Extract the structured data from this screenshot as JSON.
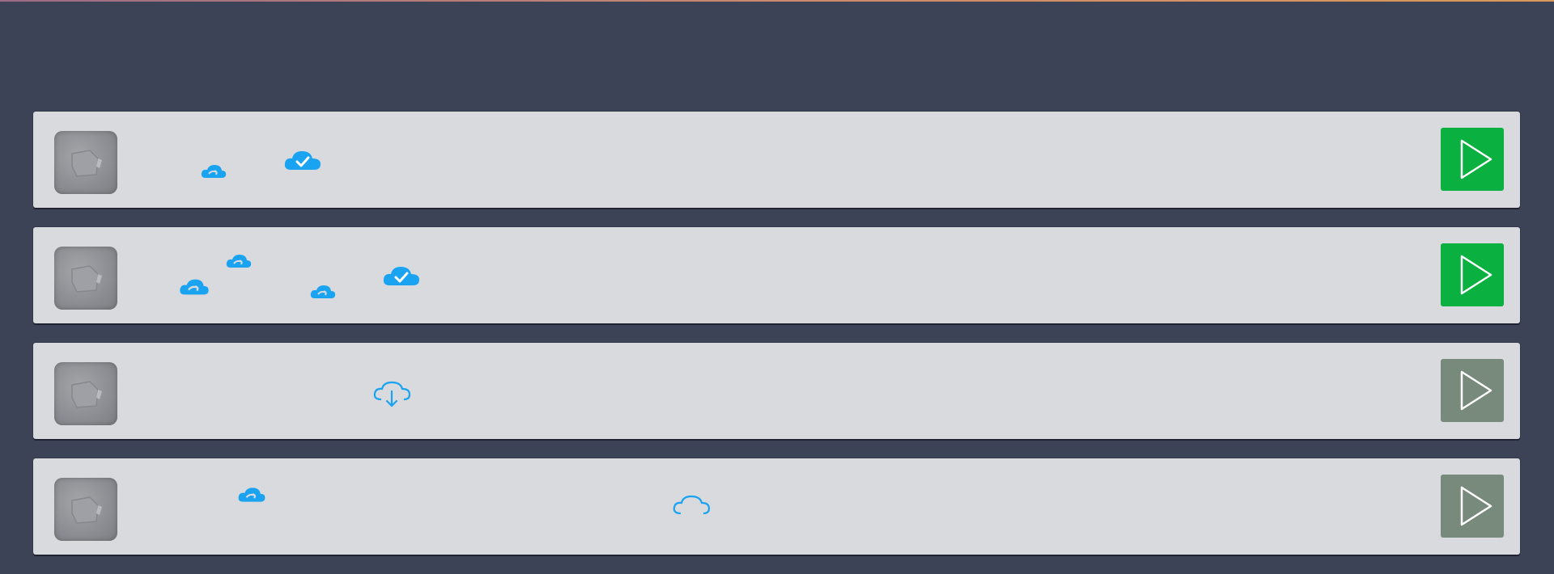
{
  "rows": [
    {
      "thumbnail_icon": "package-thumbnail-icon",
      "sync_icons": [
        "cloud-sync-icon",
        "cloud-check-icon"
      ],
      "play_enabled": true
    },
    {
      "thumbnail_icon": "package-thumbnail-icon",
      "sync_icons": [
        "cloud-sync-icon",
        "cloud-sync-icon",
        "cloud-sync-icon",
        "cloud-check-icon"
      ],
      "play_enabled": true
    },
    {
      "thumbnail_icon": "package-thumbnail-icon",
      "sync_icons": [
        "cloud-download-icon"
      ],
      "play_enabled": false
    },
    {
      "thumbnail_icon": "package-thumbnail-icon",
      "sync_icons": [
        "cloud-sync-icon",
        "cloud-download-icon"
      ],
      "play_enabled": false
    }
  ],
  "colors": {
    "background": "#3d4356",
    "row": "#d9dade",
    "cloud": "#1aa3f0",
    "play_active": "#0ab141",
    "play_inactive": "#778a7c"
  }
}
